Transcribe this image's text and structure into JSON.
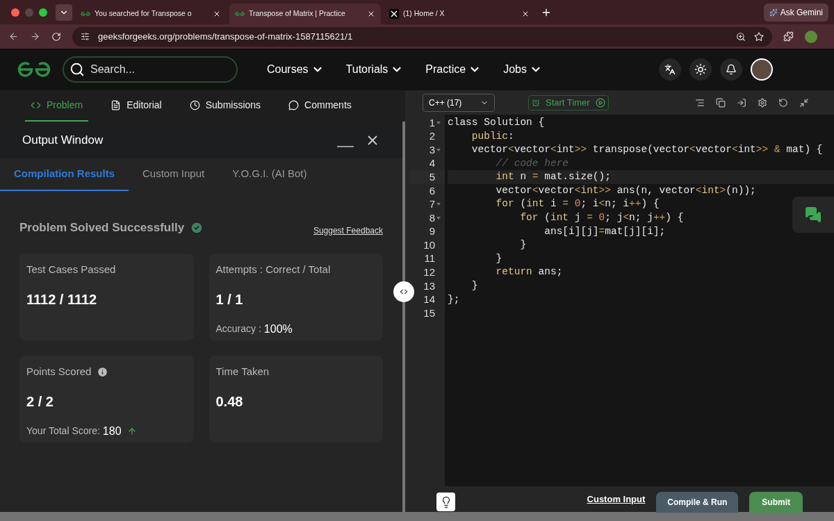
{
  "browser": {
    "tabs": [
      {
        "title": "You searched for Transpose o",
        "kind": "gfg",
        "selected": false
      },
      {
        "title": "Transpose of Matrix | Practice",
        "kind": "gfg",
        "selected": true
      },
      {
        "title": "(1) Home / X",
        "kind": "x",
        "selected": false
      }
    ],
    "ask_gemini": "Ask Gemini",
    "url": "geeksforgeeks.org/problems/transpose-of-matrix-1587115621/1"
  },
  "site_nav": {
    "search_placeholder": "Search...",
    "menus": [
      "Courses",
      "Tutorials",
      "Practice",
      "Jobs"
    ]
  },
  "problem_tabs": [
    {
      "label": "Problem",
      "kind": "code",
      "selected": true
    },
    {
      "label": "Editorial",
      "kind": "doc",
      "selected": false
    },
    {
      "label": "Submissions",
      "kind": "clock",
      "selected": false
    },
    {
      "label": "Comments",
      "kind": "chat",
      "selected": false
    }
  ],
  "output_window": {
    "title": "Output Window",
    "tabs": [
      {
        "label": "Compilation Results",
        "selected": true
      },
      {
        "label": "Custom Input",
        "selected": false
      },
      {
        "label": "Y.O.G.I. (AI Bot)",
        "selected": false
      }
    ],
    "status": "Problem Solved Successfully",
    "feedback_link": "Suggest Feedback",
    "cards": [
      {
        "label": "Test Cases Passed",
        "value": "1112 / 1112",
        "info": false
      },
      {
        "label": "Attempts : Correct / Total",
        "value": "1 / 1",
        "info": false,
        "sub_label": "Accuracy :",
        "sub_value": "100%",
        "trend_up": false
      },
      {
        "label": "Points Scored",
        "value": "2 / 2",
        "info": true,
        "sub_label": "Your Total Score:",
        "sub_value": "180",
        "trend_up": true
      },
      {
        "label": "Time Taken",
        "value": "0.48",
        "info": false
      }
    ]
  },
  "editor": {
    "language": "C++ (17)",
    "timer": "Start Timer",
    "lines": [
      {
        "number": "1",
        "fold": true,
        "active": false,
        "tokens": [
          {
            "kind": "plain",
            "text": "class Solution {"
          }
        ]
      },
      {
        "number": "2",
        "fold": false,
        "active": false,
        "tokens": [
          {
            "kind": "kw",
            "text": "    public"
          },
          {
            "kind": "plain",
            "text": ":"
          }
        ]
      },
      {
        "number": "3",
        "fold": true,
        "active": false,
        "tokens": [
          {
            "kind": "plain",
            "text": "    vector"
          },
          {
            "kind": "op",
            "text": "<"
          },
          {
            "kind": "plain",
            "text": "vector"
          },
          {
            "kind": "op",
            "text": "<"
          },
          {
            "kind": "plain",
            "text": "int"
          },
          {
            "kind": "op",
            "text": ">>"
          },
          {
            "kind": "plain",
            "text": " transpose(vector"
          },
          {
            "kind": "op",
            "text": "<"
          },
          {
            "kind": "plain",
            "text": "vector"
          },
          {
            "kind": "op",
            "text": "<"
          },
          {
            "kind": "plain",
            "text": "int"
          },
          {
            "kind": "op",
            "text": ">> &"
          },
          {
            "kind": "plain",
            "text": " mat) {"
          }
        ]
      },
      {
        "number": "4",
        "fold": false,
        "active": false,
        "tokens": [
          {
            "kind": "comment",
            "text": "        // code here"
          }
        ]
      },
      {
        "number": "5",
        "fold": false,
        "active": true,
        "tokens": [
          {
            "kind": "kw",
            "text": "        int"
          },
          {
            "kind": "plain",
            "text": " n "
          },
          {
            "kind": "op",
            "text": "="
          },
          {
            "kind": "plain",
            "text": " mat.size();"
          }
        ]
      },
      {
        "number": "6",
        "fold": false,
        "active": false,
        "tokens": [
          {
            "kind": "plain",
            "text": "        vector"
          },
          {
            "kind": "op",
            "text": "<"
          },
          {
            "kind": "plain",
            "text": "vector"
          },
          {
            "kind": "op",
            "text": "<"
          },
          {
            "kind": "kw",
            "text": "int"
          },
          {
            "kind": "op",
            "text": ">>"
          },
          {
            "kind": "plain",
            "text": " ans(n, vector"
          },
          {
            "kind": "op",
            "text": "<"
          },
          {
            "kind": "kw",
            "text": "int"
          },
          {
            "kind": "op",
            "text": ">"
          },
          {
            "kind": "plain",
            "text": "(n));"
          }
        ]
      },
      {
        "number": "7",
        "fold": true,
        "active": false,
        "tokens": [
          {
            "kind": "kw",
            "text": "        for"
          },
          {
            "kind": "plain",
            "text": " ("
          },
          {
            "kind": "kw",
            "text": "int"
          },
          {
            "kind": "plain",
            "text": " i "
          },
          {
            "kind": "op",
            "text": "= "
          },
          {
            "kind": "num",
            "text": "0"
          },
          {
            "kind": "plain",
            "text": "; i"
          },
          {
            "kind": "op",
            "text": "<"
          },
          {
            "kind": "plain",
            "text": "n; i"
          },
          {
            "kind": "op",
            "text": "++"
          },
          {
            "kind": "plain",
            "text": ") {"
          }
        ]
      },
      {
        "number": "8",
        "fold": true,
        "active": false,
        "tokens": [
          {
            "kind": "kw",
            "text": "            for"
          },
          {
            "kind": "plain",
            "text": " ("
          },
          {
            "kind": "kw",
            "text": "int"
          },
          {
            "kind": "plain",
            "text": " j "
          },
          {
            "kind": "op",
            "text": "= "
          },
          {
            "kind": "num",
            "text": "0"
          },
          {
            "kind": "plain",
            "text": "; j"
          },
          {
            "kind": "op",
            "text": "<"
          },
          {
            "kind": "plain",
            "text": "n; j"
          },
          {
            "kind": "op",
            "text": "++"
          },
          {
            "kind": "plain",
            "text": ") {"
          }
        ]
      },
      {
        "number": "9",
        "fold": false,
        "active": false,
        "tokens": [
          {
            "kind": "plain",
            "text": "                ans[i][j]"
          },
          {
            "kind": "op",
            "text": "="
          },
          {
            "kind": "plain",
            "text": "mat[j][i];"
          }
        ]
      },
      {
        "number": "10",
        "fold": false,
        "active": false,
        "tokens": [
          {
            "kind": "plain",
            "text": "            }"
          }
        ]
      },
      {
        "number": "11",
        "fold": false,
        "active": false,
        "tokens": [
          {
            "kind": "plain",
            "text": "        }"
          }
        ]
      },
      {
        "number": "12",
        "fold": false,
        "active": false,
        "tokens": [
          {
            "kind": "kw",
            "text": "        return"
          },
          {
            "kind": "plain",
            "text": " ans;"
          }
        ]
      },
      {
        "number": "13",
        "fold": false,
        "active": false,
        "tokens": [
          {
            "kind": "plain",
            "text": "    }"
          }
        ]
      },
      {
        "number": "14",
        "fold": false,
        "active": false,
        "tokens": [
          {
            "kind": "plain",
            "text": "};"
          }
        ]
      },
      {
        "number": "15",
        "fold": false,
        "active": false
      }
    ],
    "custom_input": "Custom Input",
    "compile_button": "Compile & Run",
    "submit_button": "Submit"
  }
}
